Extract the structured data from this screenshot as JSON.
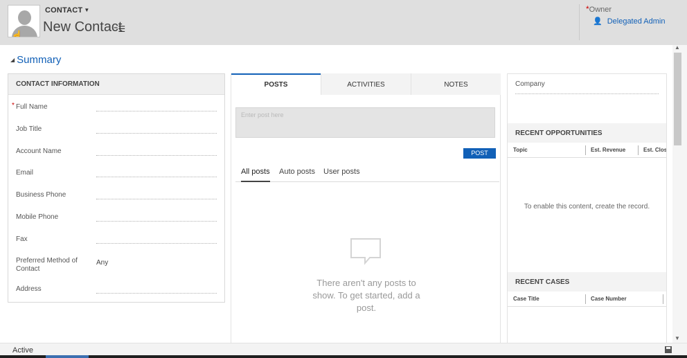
{
  "header": {
    "entity_type": "CONTACT",
    "record_title": "New Contact",
    "owner_label": "Owner",
    "owner_value": "Delegated Admin"
  },
  "section": {
    "title": "Summary"
  },
  "contact_info": {
    "heading": "CONTACT INFORMATION",
    "fields": [
      {
        "label": "Full Name",
        "value": "",
        "required": true
      },
      {
        "label": "Job Title",
        "value": ""
      },
      {
        "label": "Account Name",
        "value": ""
      },
      {
        "label": "Email",
        "value": ""
      },
      {
        "label": "Business Phone",
        "value": ""
      },
      {
        "label": "Mobile Phone",
        "value": ""
      },
      {
        "label": "Fax",
        "value": ""
      },
      {
        "label": "Preferred Method of Contact",
        "value": "Any"
      },
      {
        "label": "Address",
        "value": ""
      }
    ]
  },
  "social": {
    "tabs": [
      "POSTS",
      "ACTIVITIES",
      "NOTES"
    ],
    "active_tab": "POSTS",
    "post_placeholder": "Enter post here",
    "post_button": "POST",
    "filters": [
      "All posts",
      "Auto posts",
      "User posts"
    ],
    "active_filter": "All posts",
    "empty_message": "There aren't any posts to show. To get started, add a post."
  },
  "related": {
    "company_label": "Company",
    "opportunities": {
      "heading": "RECENT OPPORTUNITIES",
      "columns": [
        "Topic",
        "Est. Revenue",
        "Est. Clos"
      ],
      "message": "To enable this content, create the record."
    },
    "cases": {
      "heading": "RECENT CASES",
      "columns": [
        "Case Title",
        "Case Number"
      ]
    }
  },
  "footer": {
    "status": "Active"
  },
  "colors": {
    "accent": "#1160b7",
    "header_bg": "#dfdfdf",
    "required": "#cc0000"
  }
}
